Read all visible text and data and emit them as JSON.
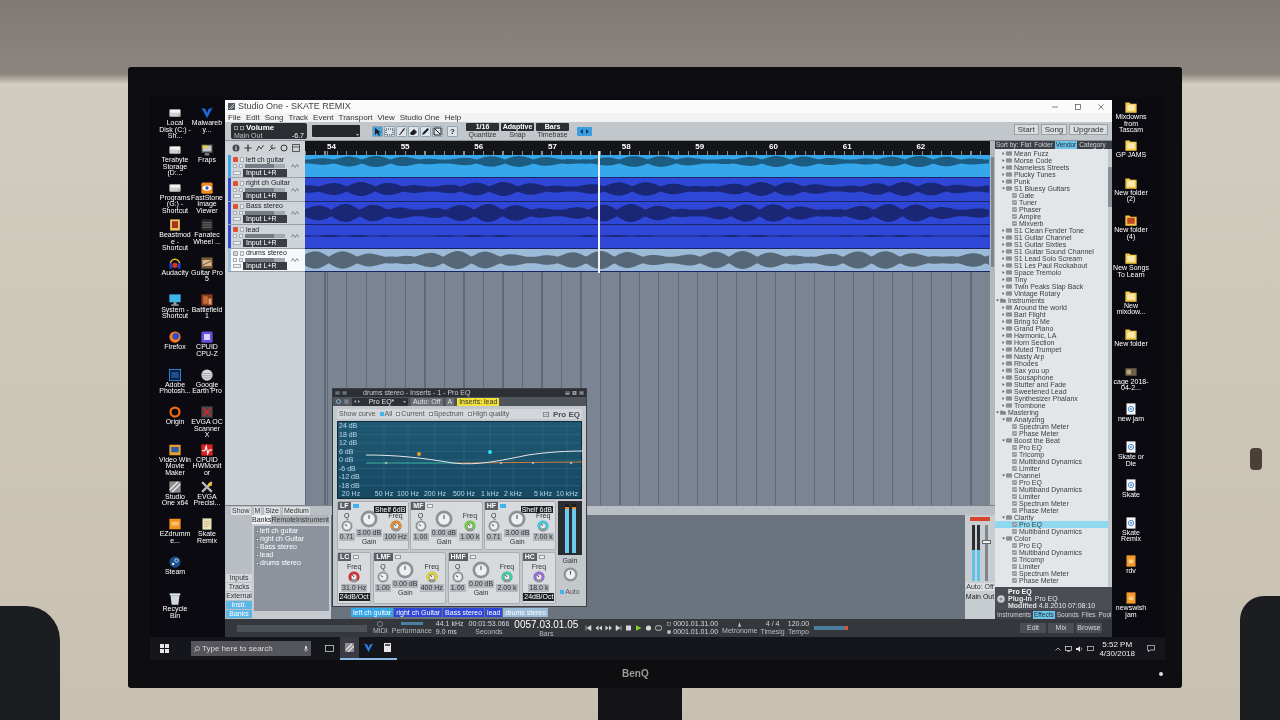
{
  "desktop": {
    "left_icons": [
      {
        "label": "Local Disk (C:) - Sh..."
      },
      {
        "label": "Terabyte Storage (D:..."
      },
      {
        "label": "Programs (G:) - Shortcut"
      },
      {
        "label": "Beastmode - Shortcut"
      },
      {
        "label": "Audacity"
      },
      {
        "label": "System - Shortcut"
      },
      {
        "label": "Firefox"
      },
      {
        "label": "Adobe Photosh..."
      },
      {
        "label": "Origin"
      },
      {
        "label": "Video Win Movie Maker"
      },
      {
        "label": "Studio One x64"
      },
      {
        "label": "EZdrumme..."
      },
      {
        "label": "Steam"
      },
      {
        "label": "Recycle Bin"
      },
      {
        "label": "Malwareby..."
      },
      {
        "label": "Fraps"
      },
      {
        "label": "FastStone Image Viewer"
      },
      {
        "label": "Fanatec Wheel ..."
      },
      {
        "label": "Guitar Pro 5"
      },
      {
        "label": "Battlefield 1"
      },
      {
        "label": "CPUID CPU-Z"
      },
      {
        "label": "Google Earth Pro"
      },
      {
        "label": "EVGA OC Scanner X"
      },
      {
        "label": "CPUID HWMonitor"
      },
      {
        "label": "EVGA Precisi..."
      },
      {
        "label": "Skate Remix"
      }
    ],
    "right_icons": [
      {
        "label": "Mixdowns from Tascam"
      },
      {
        "label": "GP JAMS"
      },
      {
        "label": "New folder (2)"
      },
      {
        "label": "New folder (4)"
      },
      {
        "label": "New Songs To Learn"
      },
      {
        "label": "New mixdow..."
      },
      {
        "label": "New folder"
      },
      {
        "label": "cage 2018-04-2..."
      },
      {
        "label": "new jam"
      },
      {
        "label": "Skate or Die"
      },
      {
        "label": "Skate"
      },
      {
        "label": "Skate Remix"
      },
      {
        "label": "rdv"
      },
      {
        "label": "newswish jam"
      }
    ]
  },
  "app": {
    "title": "Studio One - SKATE REMIX",
    "menu": [
      "File",
      "Edit",
      "Song",
      "Track",
      "Event",
      "Transport",
      "View",
      "Studio One",
      "Help"
    ],
    "toolbar": {
      "channel": "Volume",
      "output": "Main Out",
      "value": "-6.7",
      "tools": [
        {
          "selected": true
        },
        {
          "selected": false
        },
        {
          "selected": false
        },
        {
          "selected": false
        },
        {
          "selected": false
        },
        {
          "selected": false
        }
      ],
      "help": "?",
      "quantize": {
        "value": "1/16",
        "label": "Quantize"
      },
      "snap": {
        "value": "Adaptive",
        "label": "Snap"
      },
      "timebase": {
        "value": "Bars",
        "label": "Timebase"
      },
      "right_buttons": [
        "Start",
        "Song",
        "Upgrade"
      ]
    },
    "ruler": [
      "54",
      "55",
      "56",
      "57",
      "58",
      "59",
      "60",
      "61",
      "62"
    ],
    "tracks": [
      {
        "name": "left ch guitar",
        "input": "Input L+R",
        "color": "#35a7ea",
        "armed": true,
        "selected": false,
        "level": 0.72
      },
      {
        "name": "right ch Guitar",
        "input": "Input L+R",
        "color": "#2f47d6",
        "armed": true,
        "selected": false,
        "level": 0.72
      },
      {
        "name": "Bass stereo",
        "input": "Input L+R",
        "color": "#2f47d6",
        "armed": true,
        "selected": false,
        "level": 0.72
      },
      {
        "name": "lead",
        "input": "Input L+R",
        "color": "#2f47d6",
        "armed": true,
        "selected": false,
        "level": 0.72
      },
      {
        "name": "drums stereo",
        "input": "Input L+R",
        "color": "#9cbbd9",
        "armed": false,
        "selected": true,
        "level": 0.72
      }
    ],
    "console": {
      "top_row": [
        "Show",
        "M",
        "Size",
        "Medium"
      ],
      "tabs": [
        {
          "label": "Banks",
          "selected": true
        },
        {
          "label": "Remote",
          "selected": false
        },
        {
          "label": "Instrument",
          "selected": false
        }
      ],
      "channels": [
        "left ch guitar",
        "right ch Guitar",
        "Bass stereo",
        "lead",
        "drums stereo"
      ],
      "nav": [
        {
          "label": "Inputs",
          "selected": false
        },
        {
          "label": "Tracks",
          "selected": false
        },
        {
          "label": "External",
          "selected": false
        },
        {
          "label": "Instr.",
          "selected": true
        },
        {
          "label": "Banks",
          "selected": true
        }
      ],
      "strip_labels": [
        {
          "label": "left ch guitar",
          "color": "#35a7ea"
        },
        {
          "label": "right ch Guitar",
          "color": "#2f47d6"
        },
        {
          "label": "Bass stereo",
          "color": "#2f47d6"
        },
        {
          "label": "lead",
          "color": "#2f47d6"
        },
        {
          "label": "drums stereo",
          "color": "#9cbbd9"
        }
      ],
      "main_out": {
        "automation": "Auto: Off",
        "label": "Main Out",
        "level": 0.7,
        "meter": [
          {
            "level": 0.55
          },
          {
            "level": 0.55
          }
        ]
      }
    },
    "pro_eq": {
      "title": "drums stereo - Inserts - 1 - Pro EQ",
      "preset": "Pro EQ*",
      "automation": "Auto: Off",
      "compare": "A",
      "insert_tag": "Inserts: lead",
      "show_curve": "Show curve",
      "options": [
        {
          "label": "All",
          "checked": true
        },
        {
          "label": "Current",
          "checked": false
        },
        {
          "label": "Spectrum",
          "checked": false
        },
        {
          "label": "High quality",
          "checked": false
        }
      ],
      "logo": "Pro EQ",
      "db_labels": [
        "24 dB",
        "18 dB",
        "12 dB",
        "6 dB",
        "0 dB",
        "-6 dB",
        "-12 dB",
        "-18 dB"
      ],
      "freq_labels": [
        "20 Hz",
        "50 Hz",
        "100 Hz",
        "200 Hz",
        "500 Hz",
        "1 kHz",
        "2 kHz",
        "5 kHz",
        "10 kHz"
      ],
      "bands_top": [
        {
          "name": "LF",
          "on": true,
          "mode": "Shelf 6dB",
          "color": "#e08a2a",
          "knobs": [
            {
              "kind": "q",
              "label": "Q",
              "value": "0.71"
            },
            {
              "kind": "gain",
              "label": "Gain",
              "value": "3.00 dB"
            },
            {
              "kind": "freq",
              "label": "Freq",
              "value": "100 Hz"
            }
          ]
        },
        {
          "name": "MF",
          "on": false,
          "color": "#6ccf3a",
          "knobs": [
            {
              "kind": "q",
              "label": "Q",
              "value": "1.00"
            },
            {
              "kind": "gain",
              "label": "Gain",
              "value": "0.00 dB"
            },
            {
              "kind": "freq",
              "label": "Freq",
              "value": "1.00 k"
            }
          ]
        },
        {
          "name": "HF",
          "on": true,
          "mode": "Shelf 6dB",
          "color": "#3fc8e0",
          "knobs": [
            {
              "kind": "q",
              "label": "Q",
              "value": "0.71"
            },
            {
              "kind": "gain",
              "label": "Gain",
              "value": "3.00 dB"
            },
            {
              "kind": "freq",
              "label": "Freq",
              "value": "7.00 k"
            }
          ]
        }
      ],
      "bands_bottom": [
        {
          "name": "LC",
          "on": false,
          "mode": "24dB/Oct",
          "color": "#d83030",
          "knobs": [
            {
              "kind": "freq",
              "label": "Freq",
              "value": "31.0 Hz"
            }
          ]
        },
        {
          "name": "LMF",
          "on": false,
          "color": "#e0d030",
          "knobs": [
            {
              "kind": "q",
              "label": "Q",
              "value": "1.00"
            },
            {
              "kind": "gain",
              "label": "Gain",
              "value": "0.00 dB"
            },
            {
              "kind": "freq",
              "label": "Freq",
              "value": "400 Hz"
            }
          ]
        },
        {
          "name": "HMF",
          "on": false,
          "color": "#3ad0a0",
          "knobs": [
            {
              "kind": "q",
              "label": "Q",
              "value": "1.00"
            },
            {
              "kind": "gain",
              "label": "Gain",
              "value": "0.00 dB"
            },
            {
              "kind": "freq",
              "label": "Freq",
              "value": "2.00 k"
            }
          ]
        },
        {
          "name": "HC",
          "on": false,
          "mode": "24dB/Oct",
          "color": "#9a6ad8",
          "knobs": [
            {
              "kind": "freq",
              "label": "Freq",
              "value": "18.0 k"
            }
          ]
        }
      ],
      "meter": [
        {
          "level": 0.93
        },
        {
          "level": 0.93
        }
      ],
      "gain_label": "Gain",
      "auto_mode": {
        "label": "Auto",
        "checked": true
      }
    },
    "browser": {
      "sort_label": "Sort by:",
      "sort_tabs": [
        {
          "label": "Flat",
          "selected": false
        },
        {
          "label": "Folder",
          "selected": false
        },
        {
          "label": "Vendor",
          "selected": true
        },
        {
          "label": "Category",
          "selected": false
        }
      ],
      "tree_continued": [
        {
          "label": "Mean Fuzz",
          "kind": "preset",
          "expanded": false,
          "selected": false
        },
        {
          "label": "Morse Code",
          "kind": "preset",
          "expanded": false,
          "selected": false
        },
        {
          "label": "Nameless Streets",
          "kind": "preset",
          "expanded": false,
          "selected": false
        },
        {
          "label": "Plucky Tunes",
          "kind": "preset",
          "expanded": false,
          "selected": false
        },
        {
          "label": "Punk",
          "kind": "preset",
          "expanded": false,
          "selected": false
        },
        {
          "label": "S1 Bluesy Guitars",
          "kind": "preset",
          "expanded": true,
          "selected": false,
          "children": [
            {
              "label": "Gate",
              "kind": "plugin",
              "selected": false
            },
            {
              "label": "Tuner",
              "kind": "plugin",
              "selected": false
            },
            {
              "label": "Phaser",
              "kind": "plugin",
              "selected": false
            },
            {
              "label": "Ampire",
              "kind": "plugin",
              "selected": false
            },
            {
              "label": "Mixverb",
              "kind": "plugin",
              "selected": false
            }
          ]
        },
        {
          "label": "S1 Clean Fender Tone",
          "kind": "preset",
          "expanded": false,
          "selected": false
        },
        {
          "label": "S1 Guitar Channel",
          "kind": "preset",
          "expanded": false,
          "selected": false
        },
        {
          "label": "S1 Guitar Sixties",
          "kind": "preset",
          "expanded": false,
          "selected": false
        },
        {
          "label": "S1 Guitar Sound Channel",
          "kind": "preset",
          "expanded": false,
          "selected": false
        },
        {
          "label": "S1 Lead Solo Scream",
          "kind": "preset",
          "expanded": false,
          "selected": false
        },
        {
          "label": "S1 Les Paul Rockabout",
          "kind": "preset",
          "expanded": false,
          "selected": false
        },
        {
          "label": "Space Tremolo",
          "kind": "preset",
          "expanded": false,
          "selected": false
        },
        {
          "label": "Tiny",
          "kind": "preset",
          "expanded": false,
          "selected": false
        },
        {
          "label": "Twin Peaks Slap Back",
          "kind": "preset",
          "expanded": false,
          "selected": false
        },
        {
          "label": "Vintage Rotary",
          "kind": "preset",
          "expanded": false,
          "selected": false
        }
      ],
      "tree": [
        {
          "label": "Instruments",
          "kind": "folder",
          "expanded": true,
          "selected": false,
          "children": [
            {
              "label": "Around the world",
              "kind": "preset",
              "expanded": false,
              "selected": false
            },
            {
              "label": "Bari Flight",
              "kind": "preset",
              "expanded": false,
              "selected": false
            },
            {
              "label": "Bring to Me",
              "kind": "preset",
              "expanded": false,
              "selected": false
            },
            {
              "label": "Grand Piano",
              "kind": "preset",
              "expanded": false,
              "selected": false
            },
            {
              "label": "Harmonic, LA",
              "kind": "preset",
              "expanded": false,
              "selected": false
            },
            {
              "label": "Horn Section",
              "kind": "preset",
              "expanded": false,
              "selected": false
            },
            {
              "label": "Muted Trumpet",
              "kind": "preset",
              "expanded": false,
              "selected": false
            },
            {
              "label": "Nasty Arp",
              "kind": "preset",
              "expanded": false,
              "selected": false
            },
            {
              "label": "Rhodes",
              "kind": "preset",
              "expanded": false,
              "selected": false
            },
            {
              "label": "Sax you up",
              "kind": "preset",
              "expanded": false,
              "selected": false
            },
            {
              "label": "Sousaphone",
              "kind": "preset",
              "expanded": false,
              "selected": false
            },
            {
              "label": "Stutter and Fade",
              "kind": "preset",
              "expanded": false,
              "selected": false
            },
            {
              "label": "Sweetened Lead",
              "kind": "preset",
              "expanded": false,
              "selected": false
            },
            {
              "label": "Synthesizer Phalanx",
              "kind": "preset",
              "expanded": false,
              "selected": false
            },
            {
              "label": "Trombone",
              "kind": "preset",
              "expanded": false,
              "selected": false
            }
          ]
        },
        {
          "label": "Mastering",
          "kind": "folder",
          "expanded": true,
          "selected": false,
          "children": [
            {
              "label": "Analyzing",
              "kind": "preset",
              "expanded": true,
              "selected": false,
              "children": [
                {
                  "label": "Spectrum Meter",
                  "kind": "plugin",
                  "selected": false
                },
                {
                  "label": "Phase Meter",
                  "kind": "plugin",
                  "selected": false
                }
              ]
            },
            {
              "label": "Boost the Beat",
              "kind": "preset",
              "expanded": true,
              "selected": false,
              "children": [
                {
                  "label": "Pro EQ",
                  "kind": "plugin",
                  "selected": false
                },
                {
                  "label": "Tricomp",
                  "kind": "plugin",
                  "selected": false
                },
                {
                  "label": "Multiband Dynamics",
                  "kind": "plugin",
                  "selected": false
                },
                {
                  "label": "Limiter",
                  "kind": "plugin",
                  "selected": false
                }
              ]
            },
            {
              "label": "Channel",
              "kind": "preset",
              "expanded": true,
              "selected": false,
              "children": [
                {
                  "label": "Pro EQ",
                  "kind": "plugin",
                  "selected": false
                },
                {
                  "label": "Multiband Dynamics",
                  "kind": "plugin",
                  "selected": false
                },
                {
                  "label": "Limiter",
                  "kind": "plugin",
                  "selected": false
                },
                {
                  "label": "Spectrum Meter",
                  "kind": "plugin",
                  "selected": false
                },
                {
                  "label": "Phase Meter",
                  "kind": "plugin",
                  "selected": false
                }
              ]
            },
            {
              "label": "Clarity",
              "kind": "preset",
              "expanded": true,
              "selected": false,
              "children": [
                {
                  "label": "Pro EQ",
                  "kind": "plugin",
                  "selected": true
                },
                {
                  "label": "Multiband Dynamics",
                  "kind": "plugin",
                  "selected": false
                }
              ]
            },
            {
              "label": "Color",
              "kind": "preset",
              "expanded": true,
              "selected": false,
              "children": [
                {
                  "label": "Pro EQ",
                  "kind": "plugin",
                  "selected": false
                },
                {
                  "label": "Multiband Dynamics",
                  "kind": "plugin",
                  "selected": false
                },
                {
                  "label": "Tricomp",
                  "kind": "plugin",
                  "selected": false
                },
                {
                  "label": "Limiter",
                  "kind": "plugin",
                  "selected": false
                },
                {
                  "label": "Spectrum Meter",
                  "kind": "plugin",
                  "selected": false
                },
                {
                  "label": "Phase Meter",
                  "kind": "plugin",
                  "selected": false
                }
              ]
            }
          ]
        }
      ],
      "info": {
        "name": "Pro EQ",
        "plugin_label": "Plug-in",
        "plugin": "Pro EQ",
        "modified_label": "Modified",
        "modified": "4.8.2010 07:08:10"
      },
      "tabs": [
        {
          "label": "Instruments",
          "selected": false
        },
        {
          "label": "Effects",
          "selected": true
        },
        {
          "label": "Sounds",
          "selected": false
        },
        {
          "label": "Files",
          "selected": false
        },
        {
          "label": "Pool",
          "selected": false
        }
      ]
    },
    "transport": {
      "midi_label": "MIDI",
      "performance_label": "Performance",
      "sample_rate": "44.1 kHz",
      "latency": "9.0 ms",
      "seconds": "00:01:53.066",
      "seconds_label": "Seconds",
      "bars": "0057.03.01.05",
      "bars_label": "Bars",
      "loop_start": "0001.01.31.00",
      "loop_end": "0001.01.01.00",
      "metronome_label": "Metronome",
      "timesig": "4 / 4",
      "timesig_label": "Timesig",
      "tempo": "120.00",
      "tempo_label": "Tempo",
      "views": [
        {
          "label": "Edit",
          "selected": false
        },
        {
          "label": "Mix",
          "selected": false
        },
        {
          "label": "Browse",
          "selected": false
        }
      ]
    }
  },
  "taskbar": {
    "search_placeholder": "Type here to search",
    "apps": [
      {
        "selected": true
      },
      {
        "selected": false
      },
      {
        "selected": false
      }
    ],
    "time": "5:52 PM",
    "date": "4/30/2018"
  },
  "monitor": {
    "brand": "BenQ"
  }
}
